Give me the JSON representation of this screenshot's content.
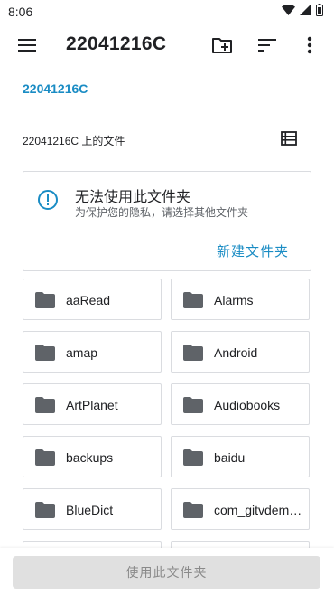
{
  "status_bar": {
    "time": "8:06"
  },
  "appbar": {
    "title": "22041216C"
  },
  "breadcrumb": {
    "current": "22041216C"
  },
  "section": {
    "title": "22041216C 上的文件"
  },
  "alert": {
    "title": "无法使用此文件夹",
    "subtitle": "为保护您的隐私，请选择其他文件夹",
    "action_label": "新建文件夹"
  },
  "folders": [
    {
      "name": "aaRead"
    },
    {
      "name": "Alarms"
    },
    {
      "name": "amap"
    },
    {
      "name": "Android"
    },
    {
      "name": "ArtPlanet"
    },
    {
      "name": "Audiobooks"
    },
    {
      "name": "backups"
    },
    {
      "name": "baidu"
    },
    {
      "name": "BlueDict"
    },
    {
      "name": "com_gitvdemo.video"
    },
    {
      "name": ""
    },
    {
      "name": ""
    }
  ],
  "bottom": {
    "use_button_label": "使用此文件夹"
  },
  "colors": {
    "accent": "#1a8cc4",
    "folder_icon": "#5f6368",
    "disabled_button": "#e0e0e0"
  }
}
